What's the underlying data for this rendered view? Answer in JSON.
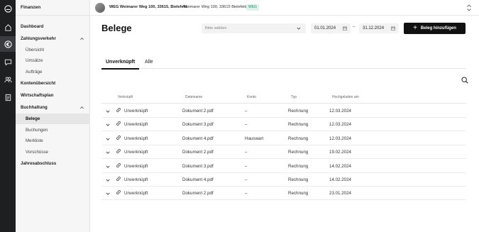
{
  "rail": {
    "icons": [
      "logo-icon",
      "home-icon",
      "euro-icon",
      "chat-icon",
      "people-icon",
      "document-icon"
    ]
  },
  "sidebar": {
    "title": "Finanzen",
    "items": [
      {
        "label": "Dashboard"
      },
      {
        "label": "Zahlungsverkehr"
      },
      {
        "label": "Übersicht"
      },
      {
        "label": "Umsätze"
      },
      {
        "label": "Aufträge"
      },
      {
        "label": "Kontenübersicht"
      },
      {
        "label": "Wirtschaftsplan"
      },
      {
        "label": "Buchhaltung"
      },
      {
        "label": "Belege"
      },
      {
        "label": "Buchungen"
      },
      {
        "label": "Merkliste"
      },
      {
        "label": "Vorschüsse"
      },
      {
        "label": "Jahresabschluss"
      }
    ]
  },
  "header": {
    "property_title": "WEG Weimarer Weg 100, 33615, Bielefeld",
    "property_address": "Weimarer Weg 100, 33615 Bielefeld",
    "badge": "WEG"
  },
  "main": {
    "title": "Belege",
    "filter_placeholder": "Bitte wählen",
    "date_from": "01.01.2024",
    "date_separator": "–",
    "date_to": "31.12.2024",
    "add_button": "Beleg hinzufügen",
    "add_icon": "+",
    "tabs": [
      {
        "label": "Unverknüpft"
      },
      {
        "label": "Alle"
      }
    ],
    "columns": [
      "Verknüpft",
      "Dateiname",
      "Konto",
      "Typ",
      "Hochgeladen am"
    ],
    "rows": [
      {
        "status": "Unverknüpft",
        "file": "Dokument 2.pdf",
        "account": "–",
        "type": "Rechnung",
        "date": "12.03.2024"
      },
      {
        "status": "Unverknüpft",
        "file": "Dokument 3.pdf",
        "account": "–",
        "type": "Rechnung",
        "date": "12.03.2024"
      },
      {
        "status": "Unverknüpft",
        "file": "Dokument 4.pdf",
        "account": "Hauswart",
        "type": "Rechnung",
        "date": "12.03.2024"
      },
      {
        "status": "Unverknüpft",
        "file": "Dokument 2.pdf",
        "account": "–",
        "type": "Rechnung",
        "date": "19.02.2024"
      },
      {
        "status": "Unverknüpft",
        "file": "Dokument 3.pdf",
        "account": "–",
        "type": "Rechnung",
        "date": "14.02.2024"
      },
      {
        "status": "Unverknüpft",
        "file": "Dokument 4.pdf",
        "account": "–",
        "type": "Rechnung",
        "date": "14.02.2024"
      },
      {
        "status": "Unverknüpft",
        "file": "Dokument 2.pdf",
        "account": "–",
        "type": "Rechnung",
        "date": "23.01.2024"
      }
    ]
  },
  "colors": {
    "rail": "#1e1f21",
    "sidebar": "#f6f6f6",
    "badge_text": "#1e8a62",
    "badge_bg": "#dff3ea",
    "primary": "#111111"
  }
}
